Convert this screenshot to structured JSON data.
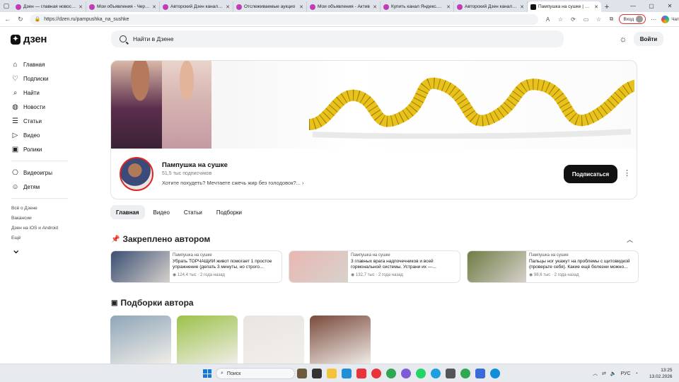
{
  "browser": {
    "tabs": [
      {
        "title": "Дзен — главная новостна"
      },
      {
        "title": "Мои объявления - Черно"
      },
      {
        "title": "Авторский Дзен канал - Я"
      },
      {
        "title": "Отслеживаемые аукцио"
      },
      {
        "title": "Мои объявления - Актив"
      },
      {
        "title": "Купить канал Яндекс.Дзе"
      },
      {
        "title": "Авторский Дзен канал - Я"
      },
      {
        "title": "Пампушка на сушке | Дзен"
      }
    ],
    "url": "https://dzen.ru/pampushka_na_sushke",
    "login_label": "Вход",
    "chat_label": "Чат"
  },
  "header": {
    "logo": "дзен",
    "search_placeholder": "Найти в Дзене",
    "login_button": "Войти"
  },
  "sidebar": {
    "items": [
      {
        "label": "Главная",
        "icon": "home-icon"
      },
      {
        "label": "Подписки",
        "icon": "heart-icon"
      },
      {
        "label": "Найти",
        "icon": "search-icon"
      },
      {
        "label": "Новости",
        "icon": "globe-icon"
      },
      {
        "label": "Статьи",
        "icon": "article-icon"
      },
      {
        "label": "Видео",
        "icon": "play-icon"
      },
      {
        "label": "Ролики",
        "icon": "shorts-icon"
      }
    ],
    "items2": [
      {
        "label": "Видеоигры",
        "icon": "gamepad-icon"
      },
      {
        "label": "Детям",
        "icon": "kids-icon"
      }
    ],
    "links": [
      "Всё о Дзене",
      "Вакансии",
      "Дзен на iOS и Android",
      "Ещё"
    ]
  },
  "channel": {
    "name": "Пампушка на сушке",
    "subscribers": "51,5 тыс подписчиков",
    "description": "Хотите похудеть? Мечтаете сжечь жир без голодовок?...",
    "subscribe_button": "Подписаться"
  },
  "channel_tabs": [
    "Главная",
    "Видео",
    "Статьи",
    "Подборки"
  ],
  "pinned": {
    "title": "Закреплено автором",
    "cards": [
      {
        "channel": "Пампушка на сушке",
        "title": "Убрать ТОРЧАЩИЙ живот помогает 1 простое упражнение (делать 3 минуты, но строго...",
        "meta": "124,4 тыс · 2 года назад",
        "thumb_color": "#3a4f73"
      },
      {
        "channel": "Пампушка на сушке",
        "title": "3 главных врага надпочечников и всей гормональной системы. Устрани их —...",
        "meta": "132,7 тыс · 2 года назад",
        "thumb_color": "#e9b7b2"
      },
      {
        "channel": "Пампушка на сушке",
        "title": "Пальцы ног укажут на проблемы с щитовидкой (проверьте себя). Какие ещё болезни можно...",
        "meta": "98,6 тыс · 2 года назад",
        "thumb_color": "#6f7c45"
      }
    ]
  },
  "collections": {
    "title": "Подборки автора",
    "items": [
      {
        "color": "#8ea6b8"
      },
      {
        "color": "#9bc24a"
      },
      {
        "color": "#e9e6e2"
      },
      {
        "color": "#7a4a3c"
      }
    ]
  },
  "taskbar": {
    "search_placeholder": "Поиск",
    "lang": "РУС",
    "time": "13:25",
    "date": "13.02.2026"
  }
}
